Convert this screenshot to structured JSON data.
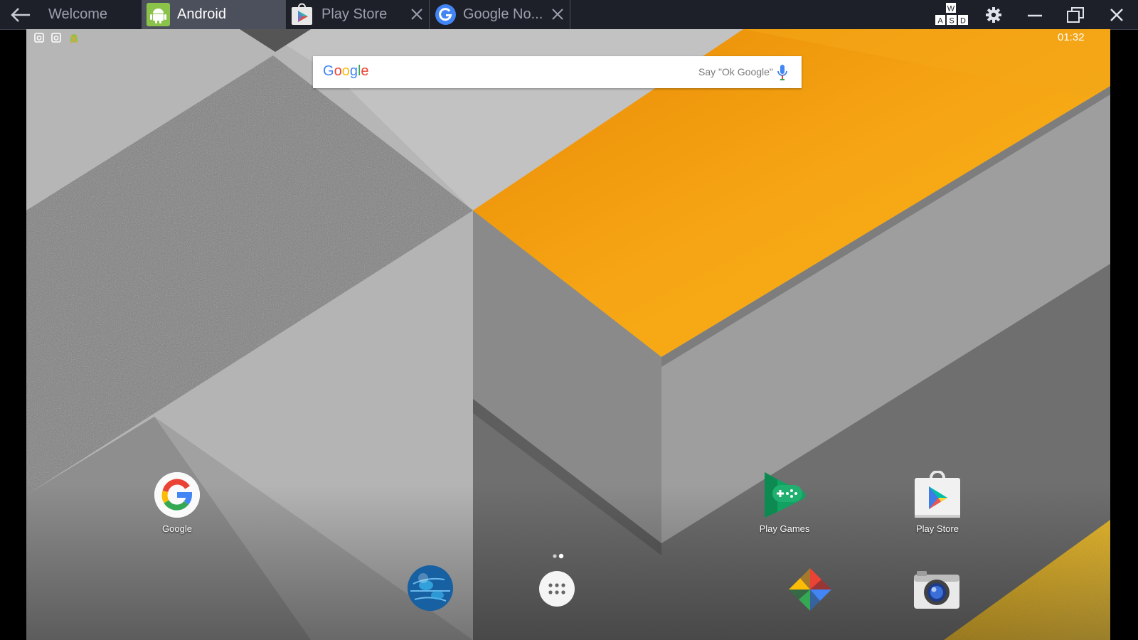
{
  "titlebar": {
    "tabs": [
      {
        "label": "Welcome",
        "active": false,
        "closable": false
      },
      {
        "label": "Android",
        "active": true,
        "closable": false
      },
      {
        "label": "Play Store",
        "active": false,
        "closable": true
      },
      {
        "label": "Google No...",
        "active": false,
        "closable": true
      }
    ],
    "keyboard_badge": {
      "top": "W",
      "bottom": [
        "A",
        "S",
        "D"
      ]
    }
  },
  "status_bar": {
    "icons": [
      "instagram-icon",
      "instagram-icon",
      "android-debug-icon"
    ],
    "clock": "01:32"
  },
  "search_widget": {
    "logo": "Google",
    "hint": "Say \"Ok Google\"",
    "icon": "mic-icon"
  },
  "desktop_apps": [
    {
      "label": "Google",
      "icon": "google-icon"
    },
    {
      "label": "Play Games",
      "icon": "play-games-icon"
    },
    {
      "label": "Play Store",
      "icon": "play-store-icon"
    }
  ],
  "dock": {
    "icons": [
      "browser-globe-icon",
      "app-drawer-icon",
      "photos-pinwheel-icon",
      "camera-icon"
    ],
    "page_indicator_count": 2
  },
  "colors": {
    "titlebar_bg": "#1e2029",
    "active_tab": "#4c4f5c",
    "wallpaper_orange": "#f5a40f",
    "wallpaper_gray": "#8f8f8f"
  }
}
